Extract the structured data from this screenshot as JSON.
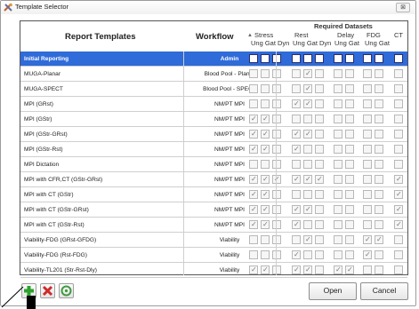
{
  "window": {
    "title": "Template Selector",
    "close_glyph": "⊠"
  },
  "header": {
    "templates": "Report Templates",
    "workflow": "Workflow",
    "required": "Required Datasets",
    "sort_arrow": "▲",
    "groups": [
      "Stress",
      "Rest",
      "Delay",
      "FDG",
      "CT"
    ],
    "subs": [
      "Ung Gat Dyn",
      "Ung Gat Dyn",
      "Ung Gat",
      "Ung Gat"
    ]
  },
  "rows": [
    {
      "name": "Initial Reporting",
      "workflow": "Admin",
      "checks": [
        0,
        0,
        0,
        0,
        0,
        0,
        0,
        0,
        0,
        0,
        0
      ],
      "selected": true
    },
    {
      "name": "MUGA-Planar",
      "workflow": "Blood Pool - Planar",
      "checks": [
        0,
        0,
        0,
        0,
        1,
        0,
        0,
        0,
        0,
        0,
        0
      ]
    },
    {
      "name": "MUGA-SPECT",
      "workflow": "Blood Pool - SPECT",
      "checks": [
        0,
        0,
        0,
        0,
        1,
        0,
        0,
        0,
        0,
        0,
        0
      ]
    },
    {
      "name": "MPI (GRst)",
      "workflow": "NM/PT MPI",
      "checks": [
        0,
        0,
        0,
        1,
        1,
        0,
        0,
        0,
        0,
        0,
        0
      ]
    },
    {
      "name": "MPI (GStr)",
      "workflow": "NM/PT MPI",
      "checks": [
        1,
        1,
        0,
        0,
        0,
        0,
        0,
        0,
        0,
        0,
        0
      ]
    },
    {
      "name": "MPI (GStr-GRst)",
      "workflow": "NM/PT MPI",
      "checks": [
        1,
        1,
        0,
        1,
        1,
        0,
        0,
        0,
        0,
        0,
        0
      ]
    },
    {
      "name": "MPI (GStr-Rst)",
      "workflow": "NM/PT MPI",
      "checks": [
        1,
        1,
        0,
        1,
        0,
        0,
        0,
        0,
        0,
        0,
        0
      ]
    },
    {
      "name": "MPI Dictation",
      "workflow": "NM/PT MPI",
      "checks": [
        0,
        0,
        0,
        0,
        0,
        0,
        0,
        0,
        0,
        0,
        0
      ]
    },
    {
      "name": "MPI with CFR,CT (GStr-GRst)",
      "workflow": "NM/PT MPI",
      "checks": [
        1,
        1,
        1,
        1,
        1,
        1,
        0,
        0,
        0,
        0,
        1
      ]
    },
    {
      "name": "MPI with CT (GStr)",
      "workflow": "NM/PT MPI",
      "checks": [
        1,
        1,
        0,
        0,
        0,
        0,
        0,
        0,
        0,
        0,
        1
      ]
    },
    {
      "name": "MPI with CT (GStr-GRst)",
      "workflow": "NM/PT MPI",
      "checks": [
        1,
        1,
        0,
        1,
        1,
        0,
        0,
        0,
        0,
        0,
        1
      ]
    },
    {
      "name": "MPI with CT (GStr-Rst)",
      "workflow": "NM/PT MPI",
      "checks": [
        1,
        1,
        0,
        1,
        0,
        0,
        0,
        0,
        0,
        0,
        1
      ]
    },
    {
      "name": "Viability-FDG (GRst-GFDG)",
      "workflow": "Viability",
      "checks": [
        0,
        0,
        0,
        0,
        1,
        0,
        0,
        0,
        1,
        1,
        0
      ]
    },
    {
      "name": "Viability-FDG (Rst-FDG)",
      "workflow": "Viability",
      "checks": [
        0,
        0,
        0,
        1,
        0,
        0,
        0,
        0,
        1,
        0,
        0
      ]
    },
    {
      "name": "Viability-TL201 (Str-Rst-Dly)",
      "workflow": "Viability",
      "checks": [
        1,
        1,
        0,
        1,
        1,
        0,
        1,
        1,
        0,
        0,
        0
      ]
    }
  ],
  "buttons": {
    "open": "Open",
    "cancel": "Cancel"
  },
  "icons": {
    "add": "add-icon",
    "delete": "delete-icon",
    "settings": "settings-icon"
  }
}
